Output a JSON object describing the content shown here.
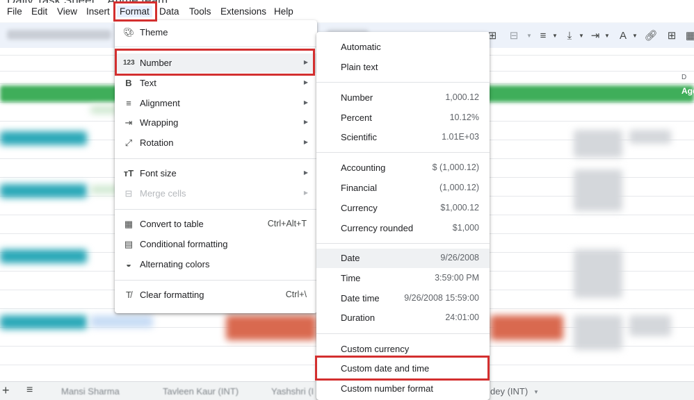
{
  "document": {
    "title": "Daily Task Sheet... Anme team"
  },
  "menubar": {
    "items": [
      "File",
      "Edit",
      "View",
      "Insert",
      "Format",
      "Data",
      "Tools",
      "Extensions",
      "Help"
    ],
    "active": "Format"
  },
  "grid": {
    "column_letter": "D",
    "header_text": "Age"
  },
  "format_menu": {
    "items": [
      {
        "icon": "palette-icon",
        "label": "Theme"
      },
      {
        "icon": "number-123-icon",
        "label": "Number",
        "submenu": true,
        "selected": true
      },
      {
        "icon": "bold-icon",
        "label": "Text",
        "submenu": true
      },
      {
        "icon": "align-icon",
        "label": "Alignment",
        "submenu": true
      },
      {
        "icon": "wrap-icon",
        "label": "Wrapping",
        "submenu": true
      },
      {
        "icon": "rotation-icon",
        "label": "Rotation",
        "submenu": true
      },
      {
        "icon": "font-size-icon",
        "label": "Font size",
        "submenu": true
      },
      {
        "icon": "merge-cells-icon",
        "label": "Merge cells",
        "submenu": true,
        "disabled": true
      },
      {
        "icon": "table-icon",
        "label": "Convert to table",
        "shortcut": "Ctrl+Alt+T"
      },
      {
        "icon": "paint-roller-icon",
        "label": "Conditional formatting"
      },
      {
        "icon": "droplet-icon",
        "label": "Alternating colors"
      },
      {
        "icon": "clear-format-icon",
        "label": "Clear formatting",
        "shortcut": "Ctrl+\\"
      }
    ]
  },
  "number_menu": {
    "items": [
      {
        "label": "Automatic",
        "example": ""
      },
      {
        "label": "Plain text",
        "example": ""
      },
      {
        "label": "Number",
        "example": "1,000.12"
      },
      {
        "label": "Percent",
        "example": "10.12%"
      },
      {
        "label": "Scientific",
        "example": "1.01E+03"
      },
      {
        "label": "Accounting",
        "example": "$ (1,000.12)"
      },
      {
        "label": "Financial",
        "example": "(1,000.12)"
      },
      {
        "label": "Currency",
        "example": "$1,000.12"
      },
      {
        "label": "Currency rounded",
        "example": "$1,000"
      },
      {
        "label": "Date",
        "example": "9/26/2008"
      },
      {
        "label": "Time",
        "example": "3:59:00 PM"
      },
      {
        "label": "Date time",
        "example": "9/26/2008 15:59:00"
      },
      {
        "label": "Duration",
        "example": "24:01:00"
      },
      {
        "label": "Custom currency",
        "example": ""
      },
      {
        "label": "Custom date and time",
        "example": "",
        "selected": true
      },
      {
        "label": "Custom number format",
        "example": ""
      }
    ]
  },
  "sheet_tabs": [
    "Mansi Sharma",
    "Tavleen Kaur (INT)",
    "Yashshri (I",
    "dey (INT)"
  ],
  "colors": {
    "highlight": "#d32f2f",
    "header_green": "#3fae5a",
    "teal_row": "#2aa8b8",
    "orange_row": "#d9694f"
  }
}
